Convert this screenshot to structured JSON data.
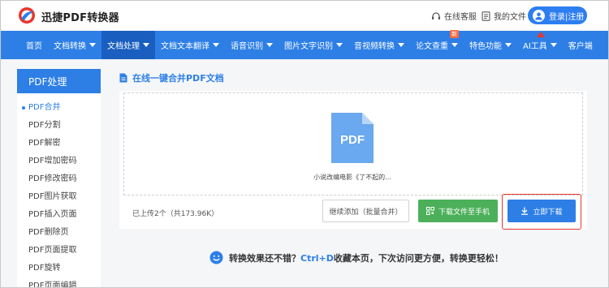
{
  "header": {
    "brand": "迅捷PDF转换器",
    "support": "在线客服",
    "my_files": "我的文件",
    "login": "登录|注册"
  },
  "nav": {
    "items": [
      {
        "label": "首页",
        "caret": false
      },
      {
        "label": "文档转换",
        "caret": true
      },
      {
        "label": "文档处理",
        "caret": true,
        "active": true
      },
      {
        "label": "文档文本翻译",
        "caret": true
      },
      {
        "label": "语音识别",
        "caret": true
      },
      {
        "label": "图片文字识别",
        "caret": true
      },
      {
        "label": "音视频转换",
        "caret": true
      },
      {
        "label": "论文查重",
        "caret": true,
        "badge": "新"
      },
      {
        "label": "特色功能",
        "caret": true
      },
      {
        "label": "AI工具",
        "caret": true
      },
      {
        "label": "客户端",
        "caret": false
      }
    ]
  },
  "sidebar": {
    "title": "PDF处理",
    "items": [
      "PDF合并",
      "PDF分割",
      "PDF解密",
      "PDF增加密码",
      "PDF修改密码",
      "PDF图片获取",
      "PDF插入页面",
      "PDF删除页",
      "PDF页面提取",
      "PDF旋转",
      "PDF页面编辑"
    ]
  },
  "main": {
    "title": "在线一键合并PDF文档",
    "file_icon_label": "PDF",
    "file_name": "小说改编电影《了不起的...",
    "status": "已上传2个（共173.96K）",
    "continue_button": "继续添加（批量合并）",
    "phone_button": "下载文件至手机",
    "download_button": "立即下载"
  },
  "promo": {
    "before": "转换效果还不错？",
    "highlight": "Ctrl+D",
    "after": "收藏本页，下次访问更方便，转换更轻松！"
  },
  "colors": {
    "primary": "#2d7fe6",
    "nav_active": "#1a5fc0",
    "green": "#4cb05a",
    "highlight_red": "#e8352c"
  }
}
